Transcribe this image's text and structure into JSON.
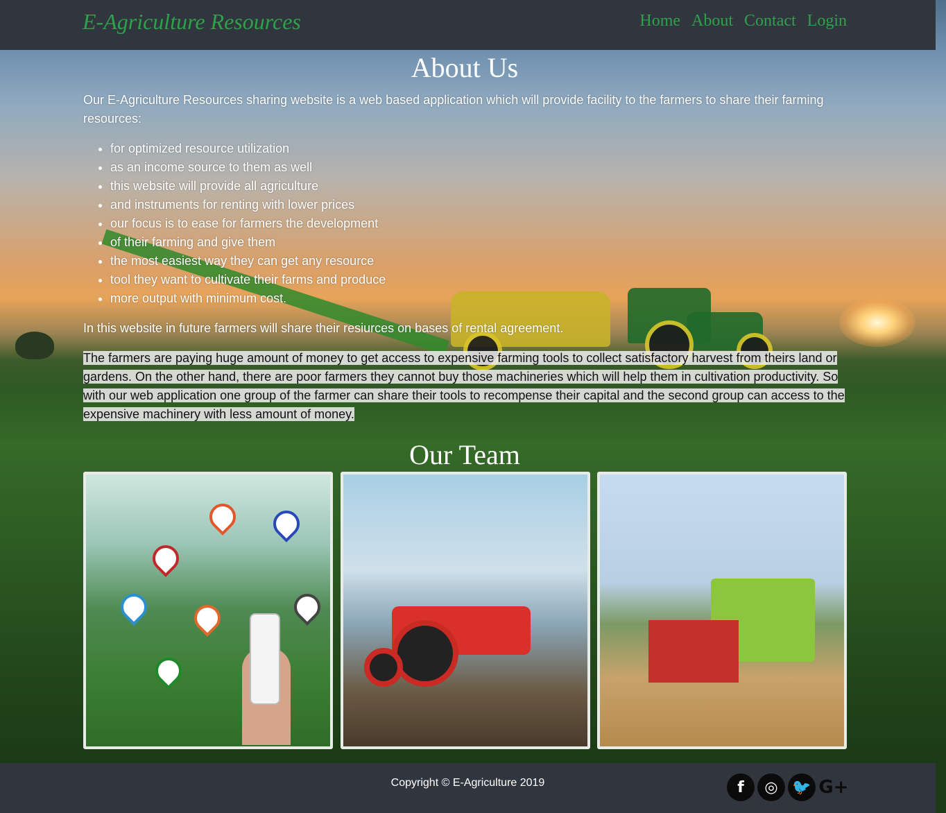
{
  "header": {
    "brand": "E-Agriculture Resources",
    "nav": [
      "Home",
      "About",
      "Contact",
      "Login"
    ]
  },
  "about": {
    "title": "About Us",
    "intro": "Our E-Agriculture Resources sharing website is a web based application which will provide facility to the farmers to share their farming resources:",
    "bullets": [
      "for optimized resource utilization",
      "as an income source to them as well",
      "this website will provide all agriculture",
      "and instruments for renting with lower prices",
      "our focus is to ease for farmers the development",
      "of their farming and give them",
      "the most easiest way they can get any resource",
      "tool they want to cultivate their farms and produce",
      "more output with minimum cost."
    ],
    "future": "In this website in future farmers will share their resiurces on bases of rental agreement.",
    "highlight": "The farmers are paying huge amount of money to get access to expensive farming tools to collect satisfactory harvest from theirs land or gardens. On the other hand, there are poor farmers they cannot buy those machineries which will help them in cultivation productivity. So with our web application one group of the farmer can share their tools to recompense their capital and the second group can access to the expensive machinery with less amount of money."
  },
  "team": {
    "title": "Our Team",
    "cards": [
      {
        "name": "smart-farming-image"
      },
      {
        "name": "red-tractor-image"
      },
      {
        "name": "harvester-image"
      }
    ]
  },
  "footer": {
    "copyright": "Copyright © E-Agriculture 2019",
    "social": [
      {
        "icon": "facebook-icon",
        "glyph": "f"
      },
      {
        "icon": "instagram-icon",
        "glyph": "◎"
      },
      {
        "icon": "twitter-icon",
        "glyph": "🐦"
      },
      {
        "icon": "google-plus-icon",
        "glyph": "G+"
      }
    ]
  },
  "colors": {
    "header_bg": "#31363e",
    "accent_green": "#2fa04b",
    "text_white": "#ffffff"
  }
}
